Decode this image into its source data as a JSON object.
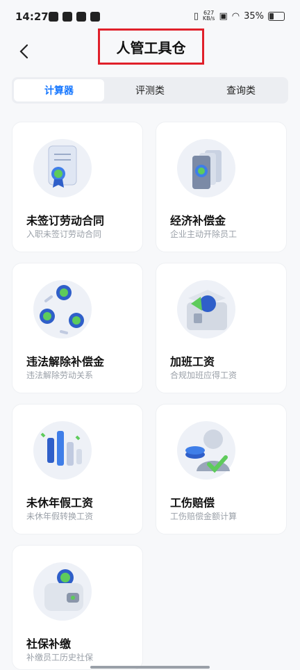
{
  "status": {
    "time": "14:27",
    "net_speed": "627\nKB/s",
    "battery": "35%"
  },
  "header": {
    "title": "人管工具仓",
    "back_glyph": "‹"
  },
  "tabs": [
    {
      "label": "计算器",
      "active": true
    },
    {
      "label": "评测类",
      "active": false
    },
    {
      "label": "查询类",
      "active": false
    }
  ],
  "cards": [
    {
      "name": "未签订劳动合同",
      "desc": "入职未签订劳动合同",
      "icon": "contract-certificate-icon"
    },
    {
      "name": "经济补偿金",
      "desc": "企业主动开除员工",
      "icon": "money-stack-icon"
    },
    {
      "name": "违法解除补偿金",
      "desc": "违法解除劳动关系",
      "icon": "coin-cycle-icon"
    },
    {
      "name": "加班工资",
      "desc": "合规加班应得工资",
      "icon": "treasure-box-icon"
    },
    {
      "name": "未休年假工资",
      "desc": "未休年假转换工资",
      "icon": "calendar-chart-icon"
    },
    {
      "name": "工伤赔偿",
      "desc": "工伤赔偿金额计算",
      "icon": "injured-worker-icon"
    },
    {
      "name": "社保补缴",
      "desc": "补缴员工历史社保",
      "icon": "wallet-icon"
    }
  ]
}
